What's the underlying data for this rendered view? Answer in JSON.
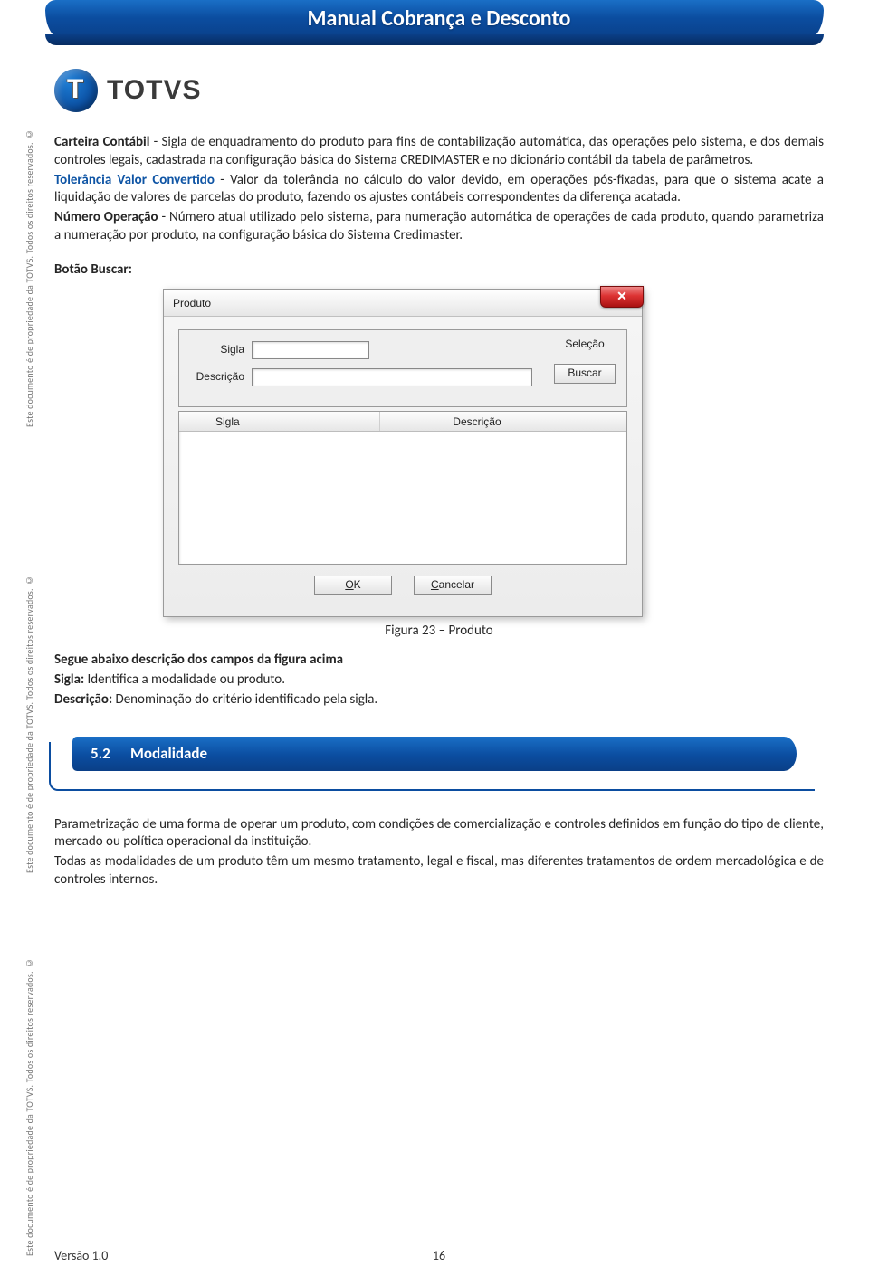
{
  "side_text": "Este documento é de propriedade da TOTVS. Todos os direitos reservados. ©",
  "header": {
    "title": "Manual Cobrança e Desconto"
  },
  "logo": {
    "text": "TOTVS"
  },
  "body": {
    "p1": {
      "lead": "Carteira Contábil",
      "rest": " - Sigla de enquadramento do produto para fins de contabilização automática, das operações pelo sistema, e dos demais controles legais, cadastrada na configuração básica do Sistema CREDIMASTER e no dicionário contábil da tabela de parâmetros."
    },
    "p2": {
      "lead": "Tolerância Valor Convertido",
      "rest": " - Valor da tolerância no cálculo do valor devido, em operações pós-fixadas, para que o sistema acate a liquidação de valores de parcelas do produto, fazendo os ajustes contábeis correspondentes da diferença acatada."
    },
    "p3": {
      "lead": "Número Operação",
      "rest": " - Número atual utilizado pelo sistema, para numeração automática de operações de cada produto, quando parametriza a numeração por produto, na configuração básica do Sistema Credimaster."
    },
    "botao_buscar_label": "Botão Buscar:"
  },
  "dialog": {
    "title": "Produto",
    "close_glyph": "✕",
    "label_sigla": "Sigla",
    "label_descricao": "Descrição",
    "side_selecao": "Seleção",
    "side_buscar": "Buscar",
    "col_sigla": "Sigla",
    "col_descricao": "Descrição",
    "btn_ok_pre": "O",
    "btn_ok_mn": "K",
    "btn_cancel_mn": "C",
    "btn_cancel_rest": "ancelar"
  },
  "figure_caption": "Figura 23 – Produto",
  "after_dialog": {
    "line1_bold": "Segue abaixo descrição dos campos da figura acima",
    "line2_bold": "Sigla:",
    "line2_rest": " Identifica a modalidade ou produto.",
    "line3_bold": "Descrição:",
    "line3_rest": " Denominação do critério identificado pela sigla."
  },
  "section": {
    "number": "5.2",
    "title": "Modalidade"
  },
  "section_body": {
    "p1": "Parametrização de uma forma de operar um produto, com condições de comercialização e controles definidos em função do tipo de cliente, mercado ou política operacional da instituição.",
    "p2": "Todas as modalidades de um produto têm um mesmo tratamento, legal e fiscal, mas diferentes tratamentos de ordem mercadológica e de controles internos."
  },
  "footer": {
    "version": "Versão 1.0",
    "page": "16"
  }
}
